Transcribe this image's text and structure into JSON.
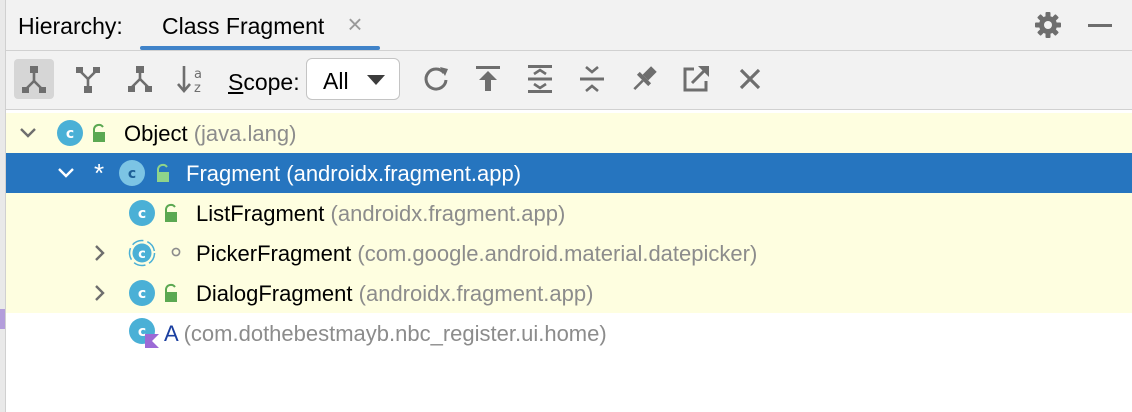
{
  "header": {
    "label": "Hierarchy:",
    "tab_label": "Class Fragment",
    "tab_close": "×",
    "settings_icon": "gear-icon",
    "minimize_icon": "minimize-icon"
  },
  "toolbar": {
    "scope_label_prefix": "S",
    "scope_label_rest": "cope:",
    "scope_value": "All",
    "buttons": [
      "type-hierarchy-icon",
      "supertypes-hierarchy-icon",
      "subtypes-hierarchy-icon",
      "sort-alphabetically-icon",
      "refresh-icon",
      "export-icon",
      "expand-all-icon",
      "collapse-all-icon",
      "pin-icon",
      "open-in-new-icon",
      "close-icon"
    ]
  },
  "tree": {
    "rows": [
      {
        "name": "Object",
        "pkg": "(java.lang)",
        "expanded": true,
        "state": "highlighted"
      },
      {
        "name": "Fragment (androidx.fragment.app)",
        "pkg": "",
        "expanded": true,
        "marker": "*",
        "state": "selected"
      },
      {
        "name": "ListFragment",
        "pkg": "(androidx.fragment.app)",
        "state": "highlighted"
      },
      {
        "name": "PickerFragment",
        "pkg": "(com.google.android.material.datepicker)",
        "expanded": false,
        "abstract": true,
        "state": "highlighted"
      },
      {
        "name": "DialogFragment",
        "pkg": "(androidx.fragment.app)",
        "expanded": false,
        "state": "highlighted"
      },
      {
        "name": "A",
        "pkg": "(com.dothebestmayb.nbc_register.ui.home)",
        "kotlin": true,
        "state": "normal"
      }
    ]
  },
  "colors": {
    "selection": "#2675bf",
    "highlight": "#fefee0",
    "tab_underline": "#4083c9",
    "class_icon": "#4ab0d6",
    "lock": "#5ba852"
  }
}
